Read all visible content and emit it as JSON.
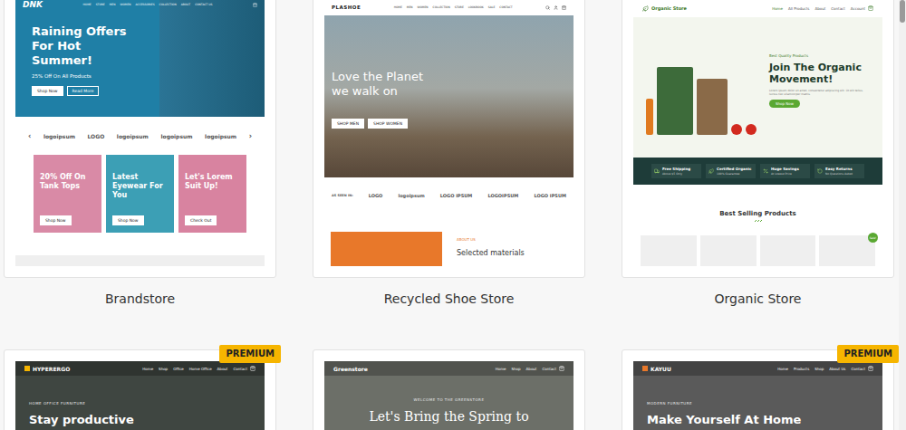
{
  "templates": [
    {
      "kind": "brandstore",
      "name": "Brandstore",
      "premium": false,
      "logo": "DNK",
      "nav": [
        "HOME",
        "STORE",
        "MEN",
        "WOMEN",
        "ACCESSORIES",
        "COLLECTION",
        "ABOUT",
        "CONTACT US"
      ],
      "hero": {
        "title": "Raining Offers For Hot Summer!",
        "subtitle": "25% Off On All Products",
        "buttons": [
          "Shop Now",
          "Read More"
        ]
      },
      "arrows": [
        "‹",
        "›"
      ],
      "logos": [
        "logoipsum",
        "LOGO",
        "logoipsum",
        "logoipsum",
        "logoipsum"
      ],
      "tiles": [
        {
          "title": "20% Off On Tank Tops",
          "button": "Shop Now",
          "color": "#d98aa6"
        },
        {
          "title": "Latest Eyewear For You",
          "button": "Shop Now",
          "color": "#3c9fb5"
        },
        {
          "title": "Let's Lorem Suit Up!",
          "button": "Check Out",
          "color": "#d883a0"
        }
      ]
    },
    {
      "kind": "shoe",
      "name": "Recycled Shoe Store",
      "premium": false,
      "logo": "PLASHOE",
      "nav": [
        "HOME",
        "MEN",
        "WOMEN",
        "COLLECTION",
        "STORE",
        "LOOKBOOK",
        "SALE",
        "CONTACT"
      ],
      "hero": {
        "title": "Love the Planet we walk on",
        "buttons": [
          "SHOP MEN",
          "SHOP WOMEN"
        ]
      },
      "logos_label": "AS SEEN IN:",
      "logos": [
        "LOGO",
        "logoipsum",
        "LOGO IPSUM",
        "LOGOIPSUM",
        "LOGO IPSUM"
      ],
      "about": {
        "label": "ABOUT US",
        "title": "Selected materials"
      }
    },
    {
      "kind": "organic",
      "name": "Organic Store",
      "premium": false,
      "logo": "Organic Store",
      "nav": [
        "Home",
        "All Products",
        "About",
        "Contact",
        "Account"
      ],
      "hero": {
        "eyebrow": "Best Quality Products",
        "title": "Join The Organic Movement!",
        "text": "Lorem ipsum dolor sit amet, consectetur adipiscing elit. Ut elit tellus, luctus nec ullamcorper mattis.",
        "button": "Shop Now"
      },
      "features": [
        {
          "title": "Free Shipping",
          "text": "Above $5 Only"
        },
        {
          "title": "Certified Organic",
          "text": "100% Guarantee"
        },
        {
          "title": "Huge Savings",
          "text": "At Lowest Price"
        },
        {
          "title": "Easy Returns",
          "text": "No Questions Asked"
        }
      ],
      "section_title": "Best Selling Products",
      "sale_badge": "Sale!",
      "products": [
        {
          "sale": false
        },
        {
          "sale": false
        },
        {
          "sale": false
        },
        {
          "sale": true
        }
      ]
    },
    {
      "kind": "banner",
      "premium": true,
      "badge": "PREMIUM",
      "logo": "HYPERERGO",
      "nav": [
        "Home",
        "Shop",
        "Office",
        "Home Office",
        "About",
        "Contact"
      ],
      "eyebrow": "HOME OFFICE FURNITURE",
      "title": "Stay productive"
    },
    {
      "kind": "spotlight",
      "premium": false,
      "logo": "Greenstore",
      "nav": [
        "Home",
        "Shop",
        "About",
        "Contact"
      ],
      "eyebrow": "WELCOME TO THE GREENSTORE",
      "title": "Let's Bring the Spring to"
    },
    {
      "kind": "banner",
      "premium": true,
      "badge": "PREMIUM",
      "logo": "KAYUU",
      "nav": [
        "Home",
        "Products",
        "Shop",
        "About Us",
        "Contact"
      ],
      "eyebrow": "MODERN FURNITURE",
      "title": "Make Yourself At Home"
    }
  ]
}
